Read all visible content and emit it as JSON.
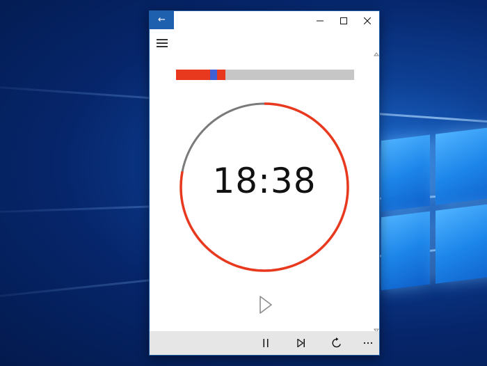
{
  "window": {
    "back_icon": "arrow-left-icon",
    "caption_icons": [
      "minimize-icon",
      "maximize-icon",
      "close-icon"
    ]
  },
  "menu_icon": "hamburger-menu-icon",
  "timer": {
    "time": "18:38",
    "progress_fraction": 0.276,
    "marker_fraction": 0.19,
    "ring_remaining_fraction": 0.78,
    "colors": {
      "accent": "#e8391f",
      "remaining_ring": "#e8391f",
      "elapsed_ring": "#7a7a7a",
      "progress_marker": "#3f5fd4",
      "progress_track": "#c6c6c6",
      "title_accent": "#1e5fae"
    }
  },
  "controls": {
    "play_icon": "play-icon",
    "bottom_icons": [
      "pause-icon",
      "skip-next-icon",
      "reset-icon",
      "more-icon"
    ]
  }
}
